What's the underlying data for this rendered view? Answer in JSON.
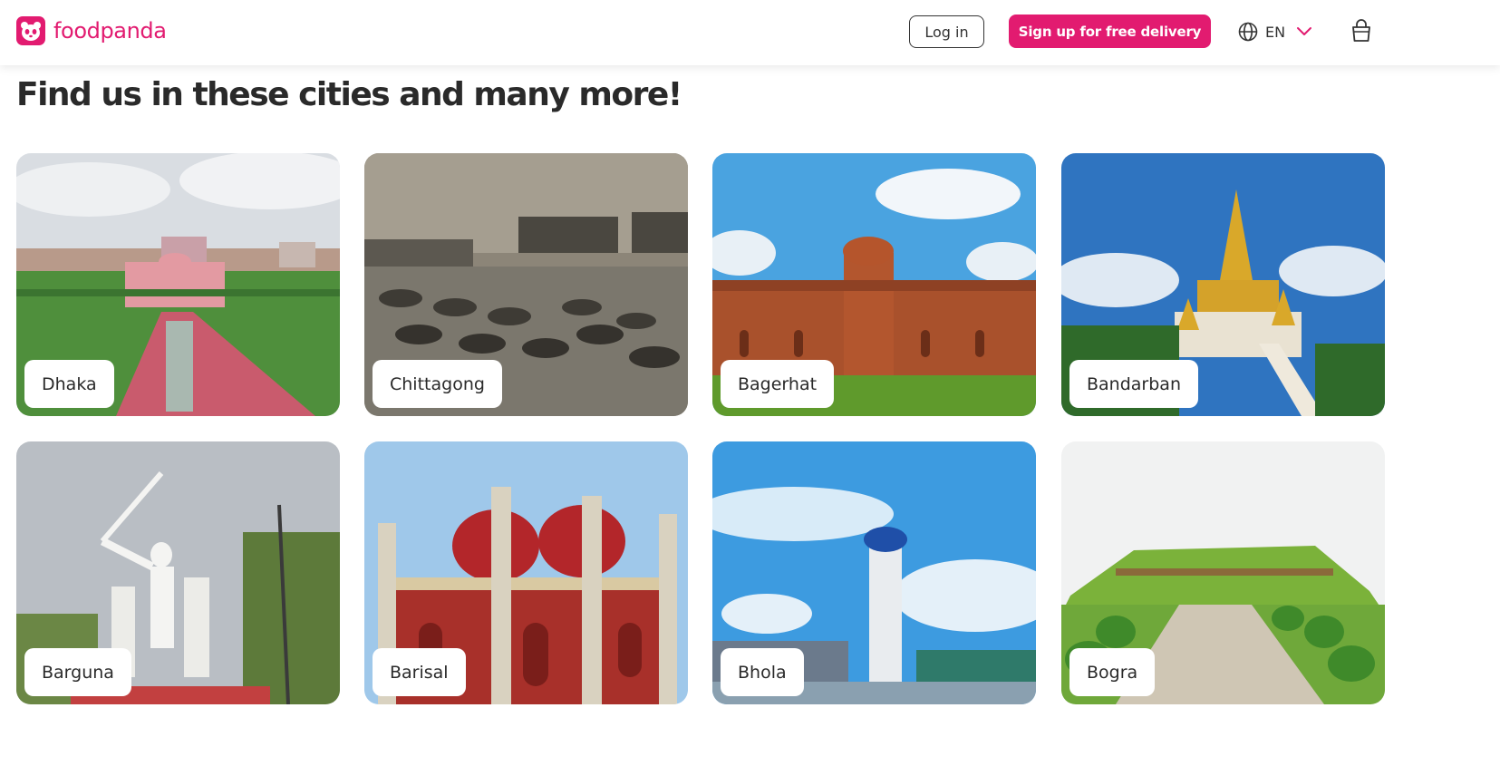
{
  "header": {
    "brand": "foodpanda",
    "login_label": "Log in",
    "signup_label": "Sign up for free delivery",
    "language_code": "EN",
    "accent_color": "#e21b70"
  },
  "main": {
    "title": "Find us in these cities and many more!",
    "cities": [
      {
        "name": "Dhaka",
        "scene": "red fort mausoleum with garden"
      },
      {
        "name": "Chittagong",
        "scene": "harbor with boats and ships"
      },
      {
        "name": "Bagerhat",
        "scene": "brick mosque under blue sky"
      },
      {
        "name": "Bandarban",
        "scene": "golden pagoda temple"
      },
      {
        "name": "Barguna",
        "scene": "white liberation war statue"
      },
      {
        "name": "Barisal",
        "scene": "red domed mosque"
      },
      {
        "name": "Bhola",
        "scene": "observation tower by water"
      },
      {
        "name": "Bogra",
        "scene": "green terraced ruins with path"
      }
    ]
  },
  "icons": {
    "logo": "panda-logo-icon",
    "language": "globe-icon",
    "dropdown": "chevron-down-icon",
    "cart": "shopping-bag-icon"
  }
}
